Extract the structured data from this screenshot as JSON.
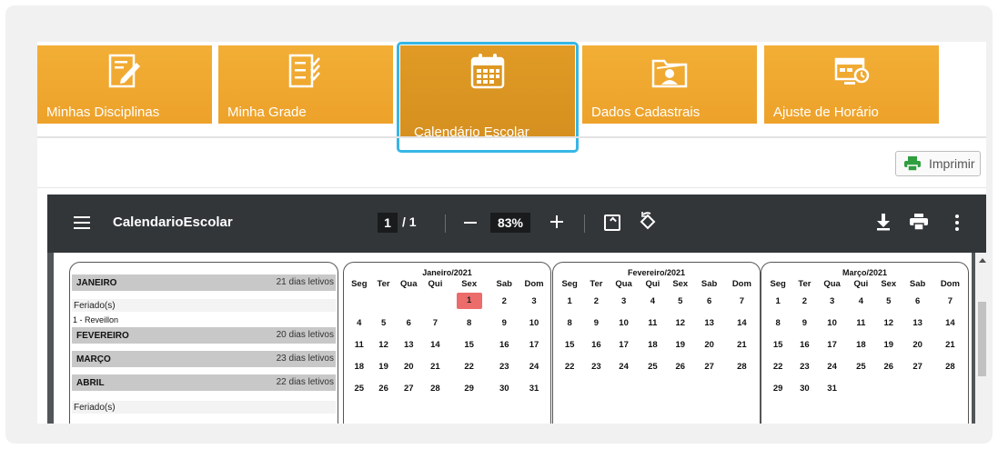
{
  "menu": {
    "tiles": [
      {
        "label": "Minhas Disciplinas",
        "icon": "edit-document-icon"
      },
      {
        "label": "Minha Grade",
        "icon": "checklist-icon"
      },
      {
        "label": "Calendário Escolar",
        "icon": "calendar-icon"
      },
      {
        "label": "Dados Cadastrais",
        "icon": "user-folder-icon"
      },
      {
        "label": "Ajuste de Horário",
        "icon": "schedule-adjust-icon"
      }
    ],
    "active_index": 2
  },
  "print_button": {
    "label": "Imprimir",
    "icon": "printer-icon"
  },
  "viewer": {
    "doc_title": "CalendarioEscolar",
    "page_current": "1",
    "page_total": "/ 1",
    "zoom": "83%"
  },
  "months": {
    "jan": {
      "name": "JANEIRO",
      "days": "21 dias letivos"
    },
    "holiday_label": "Feriado(s)",
    "jan_holiday": "1 - Reveillon",
    "feb": {
      "name": "FEVEREIRO",
      "days": "20 dias letivos"
    },
    "mar": {
      "name": "MARÇO",
      "days": "23 dias letivos"
    },
    "apr": {
      "name": "ABRIL",
      "days": "22 dias letivos"
    },
    "apr_holiday_label": "Feriado(s)"
  },
  "weekdays": [
    "Seg",
    "Ter",
    "Qua",
    "Qui",
    "Sex",
    "Sab",
    "Dom"
  ],
  "calendars": [
    {
      "title": "Janeiro/2021",
      "weeks": [
        [
          "",
          "",
          "",
          "",
          "1",
          "2",
          "3"
        ],
        [
          "4",
          "5",
          "6",
          "7",
          "8",
          "9",
          "10"
        ],
        [
          "11",
          "12",
          "13",
          "14",
          "15",
          "16",
          "17"
        ],
        [
          "18",
          "19",
          "20",
          "21",
          "22",
          "23",
          "24"
        ],
        [
          "25",
          "26",
          "27",
          "28",
          "29",
          "30",
          "31"
        ]
      ],
      "highlight": "1",
      "highlight_color": "#ec6b6b"
    },
    {
      "title": "Fevereiro/2021",
      "weeks": [
        [
          "1",
          "2",
          "3",
          "4",
          "5",
          "6",
          "7"
        ],
        [
          "8",
          "9",
          "10",
          "11",
          "12",
          "13",
          "14"
        ],
        [
          "15",
          "16",
          "17",
          "18",
          "19",
          "20",
          "21"
        ],
        [
          "22",
          "23",
          "24",
          "25",
          "26",
          "27",
          "28"
        ],
        [
          "",
          "",
          "",
          "",
          "",
          "",
          ""
        ]
      ],
      "highlight": ""
    },
    {
      "title": "Março/2021",
      "weeks": [
        [
          "1",
          "2",
          "3",
          "4",
          "5",
          "6",
          "7"
        ],
        [
          "8",
          "9",
          "10",
          "11",
          "12",
          "13",
          "14"
        ],
        [
          "15",
          "16",
          "17",
          "18",
          "19",
          "20",
          "21"
        ],
        [
          "22",
          "23",
          "24",
          "25",
          "26",
          "27",
          "28"
        ],
        [
          "29",
          "30",
          "31",
          "",
          "",
          "",
          ""
        ]
      ],
      "highlight": ""
    }
  ],
  "colors": {
    "tile": "#f0a830",
    "tile_active": "#d6901f",
    "active_outline": "#37b6e6",
    "toolbar": "#323639"
  }
}
